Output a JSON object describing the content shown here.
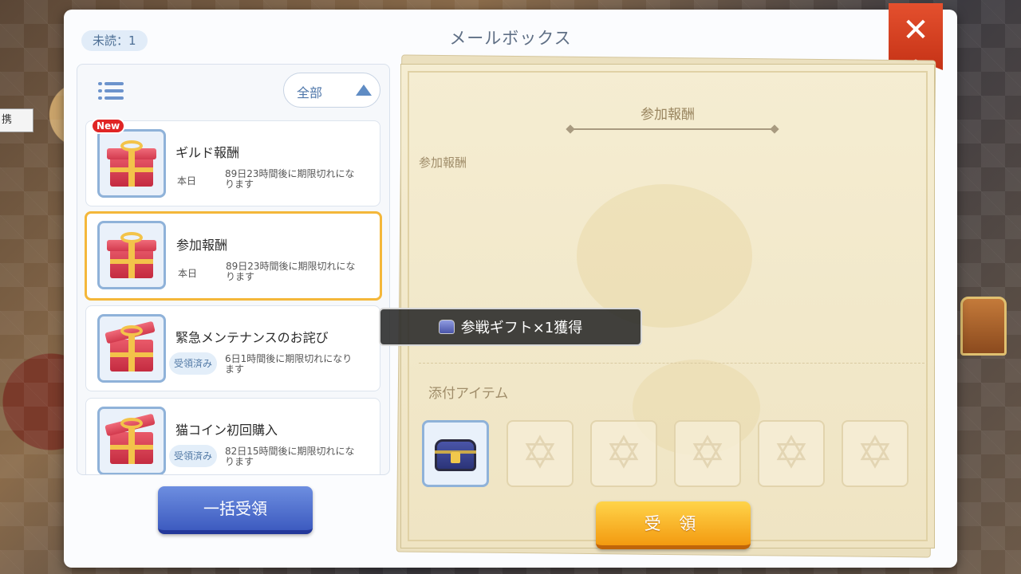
{
  "background": {
    "side_label": "携"
  },
  "mailbox": {
    "title": "メールボックス",
    "unread": "未読：1",
    "filter_label": "全部",
    "mails": [
      {
        "subject": "ギルド報酬",
        "date": "本日",
        "expiry": "89日23時間後に期限切れになります",
        "badge": "New",
        "claimed": "",
        "selected": false
      },
      {
        "subject": "参加報酬",
        "date": "本日",
        "expiry": "89日23時間後に期限切れになります",
        "badge": "",
        "claimed": "",
        "selected": true
      },
      {
        "subject": "緊急メンテナンスのお詫び",
        "date": "",
        "expiry": "6日1時間後に期限切れになります",
        "badge": "",
        "claimed": "受領済み",
        "selected": false
      },
      {
        "subject": "猫コイン初回購入",
        "date": "",
        "expiry": "82日15時間後に期限切れになります",
        "badge": "",
        "claimed": "受領済み",
        "selected": false
      }
    ],
    "bulk_button": "一括受領"
  },
  "detail": {
    "heading": "参加報酬",
    "body": "参加報酬",
    "attachments_label": "添付アイテム",
    "slots": [
      {
        "filled": true,
        "icon": "treasure-chest-icon"
      },
      {
        "filled": false,
        "icon": "star-of-david-icon"
      },
      {
        "filled": false,
        "icon": "star-of-david-icon"
      },
      {
        "filled": false,
        "icon": "star-of-david-icon"
      },
      {
        "filled": false,
        "icon": "star-of-david-icon"
      },
      {
        "filled": false,
        "icon": "star-of-david-icon"
      }
    ],
    "receive_button": "受 領"
  },
  "toast": {
    "text": "参戦ギフト×1獲得"
  },
  "colors": {
    "accent_blue": "#3d5bc0",
    "accent_orange": "#f39a10",
    "close_red": "#d63a1c",
    "selected_border": "#f4b73a"
  }
}
